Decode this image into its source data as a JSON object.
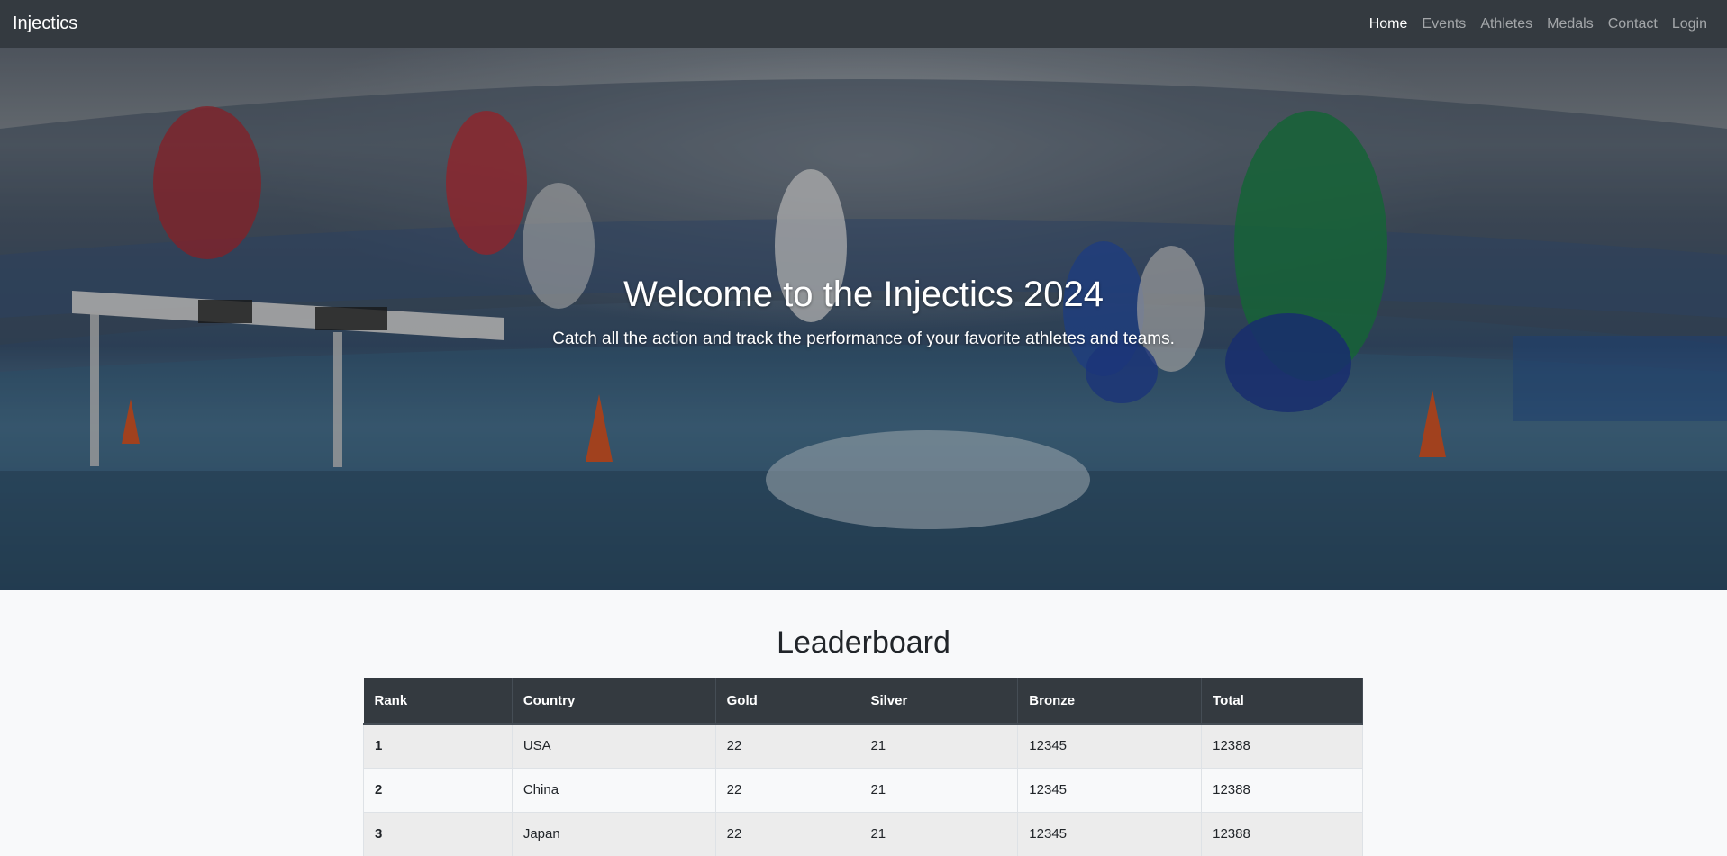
{
  "navbar": {
    "brand": "Injectics",
    "links": [
      "Home",
      "Events",
      "Athletes",
      "Medals",
      "Contact",
      "Login"
    ],
    "active": "Home"
  },
  "hero": {
    "title": "Welcome to the Injectics 2024",
    "subtitle": "Catch all the action and track the performance of your favorite athletes and teams."
  },
  "leaderboard": {
    "title": "Leaderboard",
    "columns": [
      "Rank",
      "Country",
      "Gold",
      "Silver",
      "Bronze",
      "Total"
    ],
    "rows": [
      [
        "1",
        "USA",
        "22",
        "21",
        "12345",
        "12388"
      ],
      [
        "2",
        "China",
        "22",
        "21",
        "12345",
        "12388"
      ],
      [
        "3",
        "Japan",
        "22",
        "21",
        "12345",
        "12388"
      ]
    ]
  },
  "colors": {
    "navbar_bg": "#343a40",
    "table_header_bg": "#343a40",
    "page_bg": "#f8f9fa"
  }
}
